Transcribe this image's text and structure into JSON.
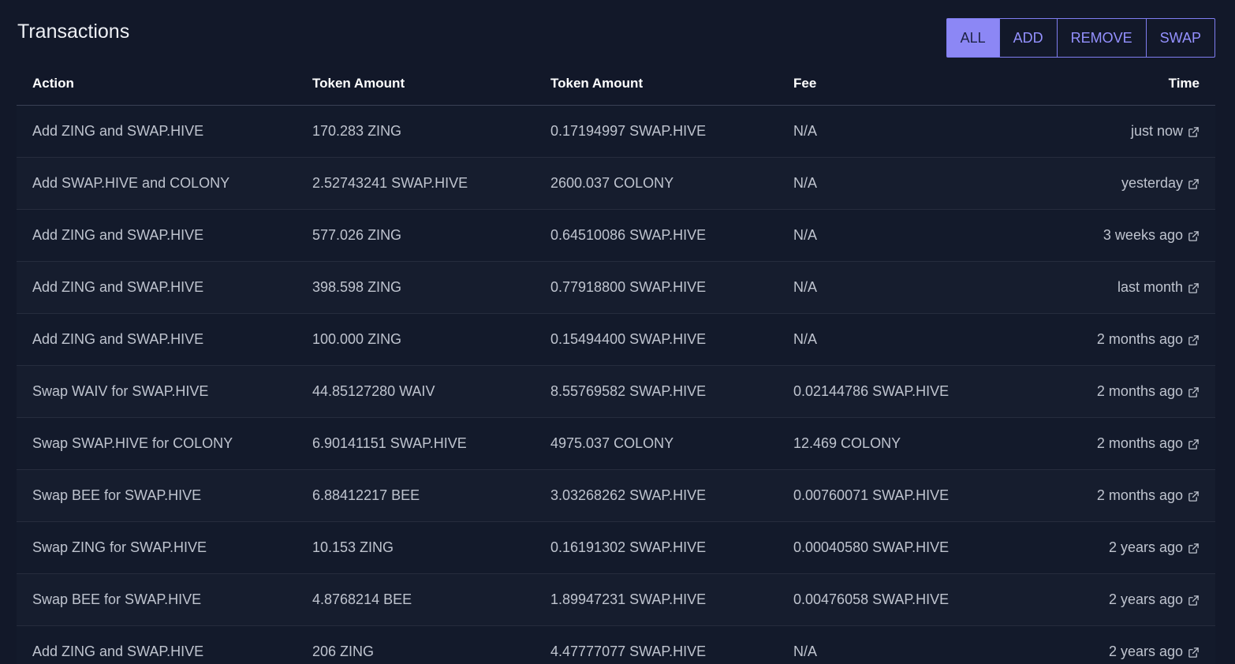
{
  "title": "Transactions",
  "filters": [
    "ALL",
    "ADD",
    "REMOVE",
    "SWAP"
  ],
  "active_filter": "ALL",
  "columns": {
    "action": "Action",
    "token_amount_1": "Token Amount",
    "token_amount_2": "Token Amount",
    "fee": "Fee",
    "time": "Time"
  },
  "rows": [
    {
      "action": "Add ZING and SWAP.HIVE",
      "amount1": "170.283 ZING",
      "amount2": "0.17194997 SWAP.HIVE",
      "fee": "N/A",
      "time": "just now"
    },
    {
      "action": "Add SWAP.HIVE and COLONY",
      "amount1": "2.52743241 SWAP.HIVE",
      "amount2": "2600.037 COLONY",
      "fee": "N/A",
      "time": "yesterday"
    },
    {
      "action": "Add ZING and SWAP.HIVE",
      "amount1": "577.026 ZING",
      "amount2": "0.64510086 SWAP.HIVE",
      "fee": "N/A",
      "time": "3 weeks ago"
    },
    {
      "action": "Add ZING and SWAP.HIVE",
      "amount1": "398.598 ZING",
      "amount2": "0.77918800 SWAP.HIVE",
      "fee": "N/A",
      "time": "last month"
    },
    {
      "action": "Add ZING and SWAP.HIVE",
      "amount1": "100.000 ZING",
      "amount2": "0.15494400 SWAP.HIVE",
      "fee": "N/A",
      "time": "2 months ago"
    },
    {
      "action": "Swap WAIV for SWAP.HIVE",
      "amount1": "44.85127280 WAIV",
      "amount2": "8.55769582 SWAP.HIVE",
      "fee": "0.02144786 SWAP.HIVE",
      "time": "2 months ago"
    },
    {
      "action": "Swap SWAP.HIVE for COLONY",
      "amount1": "6.90141151 SWAP.HIVE",
      "amount2": "4975.037 COLONY",
      "fee": "12.469 COLONY",
      "time": "2 months ago"
    },
    {
      "action": "Swap BEE for SWAP.HIVE",
      "amount1": "6.88412217 BEE",
      "amount2": "3.03268262 SWAP.HIVE",
      "fee": "0.00760071 SWAP.HIVE",
      "time": "2 months ago"
    },
    {
      "action": "Swap ZING for SWAP.HIVE",
      "amount1": "10.153 ZING",
      "amount2": "0.16191302 SWAP.HIVE",
      "fee": "0.00040580 SWAP.HIVE",
      "time": "2 years ago"
    },
    {
      "action": "Swap BEE for SWAP.HIVE",
      "amount1": "4.8768214 BEE",
      "amount2": "1.89947231 SWAP.HIVE",
      "fee": "0.00476058 SWAP.HIVE",
      "time": "2 years ago"
    },
    {
      "action": "Add ZING and SWAP.HIVE",
      "amount1": "206 ZING",
      "amount2": "4.47777077 SWAP.HIVE",
      "fee": "N/A",
      "time": "2 years ago"
    }
  ],
  "row_link_icon": "external-link-icon"
}
